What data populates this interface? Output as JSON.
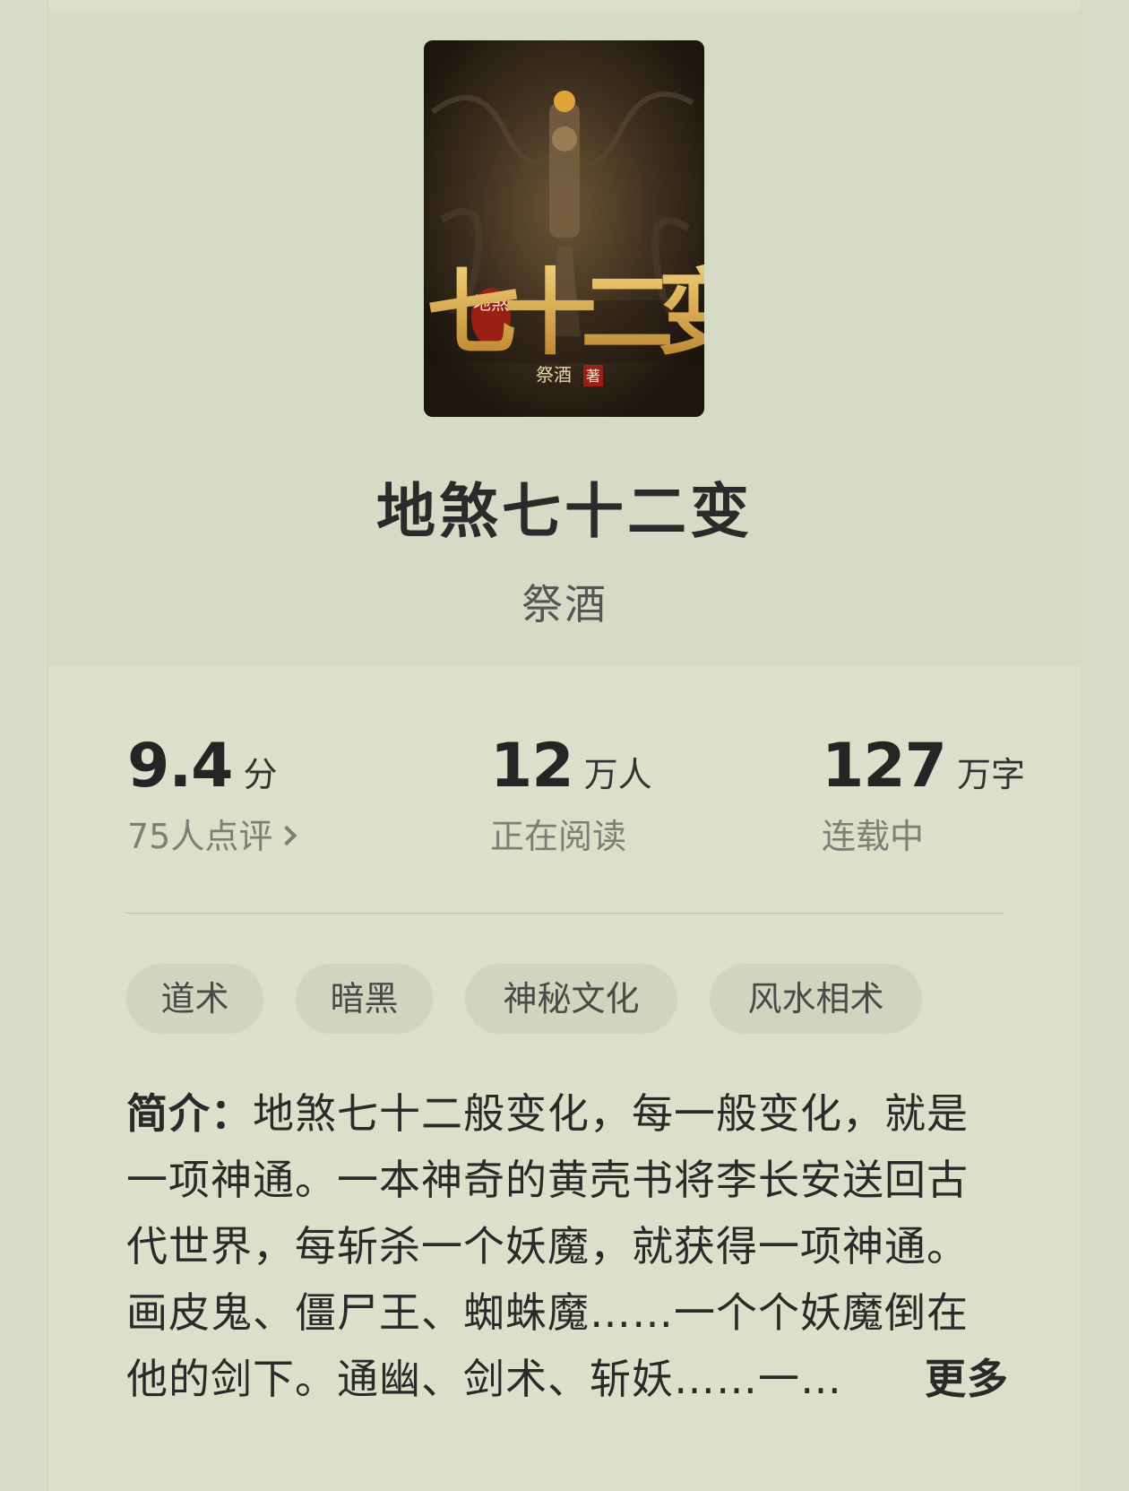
{
  "book": {
    "cover_icon": "book-cover-image",
    "cover_small_title": "地煞",
    "cover_big_title": "七十二变",
    "cover_author": "祭酒",
    "cover_author_suffix": "著",
    "title": "地煞七十二变",
    "author": "祭酒"
  },
  "stats": {
    "score": "9.4",
    "score_unit": "分",
    "reviews": "75人点评",
    "readers": "12",
    "readers_unit": "万人",
    "readers_label": "正在阅读",
    "words": "127",
    "words_unit": "万字",
    "status": "连载中"
  },
  "tags": [
    "道术",
    "暗黑",
    "神秘文化",
    "风水相术"
  ],
  "intro": {
    "label": "简介：",
    "text": "地煞七十二般变化，每一般变化，就是一项神通。一本神奇的黄壳书将李长安送回古代世界，每斩杀一个妖魔，就获得一项神通。画皮鬼、僵尸王、蜘蛛魔……一个个妖魔倒在他的剑下。通幽、剑术、斩妖……一…",
    "more": "更多"
  }
}
